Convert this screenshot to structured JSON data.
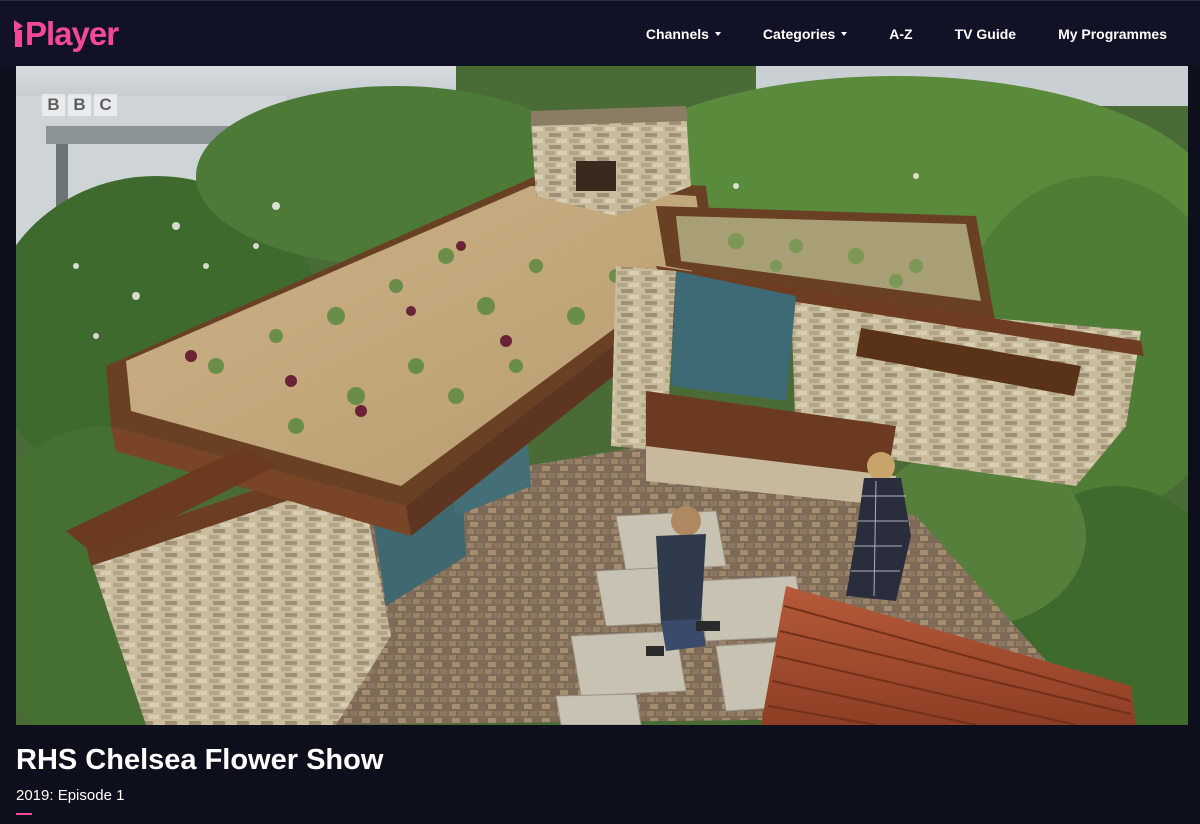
{
  "app": {
    "logo_text": "Player",
    "logo_icon": "iplayer-i-icon",
    "accent_color": "#f54997",
    "background_color": "#0e0f1d"
  },
  "nav": {
    "items": [
      {
        "label": "Channels",
        "has_dropdown": true
      },
      {
        "label": "Categories",
        "has_dropdown": true
      },
      {
        "label": "A-Z",
        "has_dropdown": false
      },
      {
        "label": "TV Guide",
        "has_dropdown": false
      },
      {
        "label": "My Programmes",
        "has_dropdown": false
      }
    ]
  },
  "player": {
    "channel_watermark": [
      "B",
      "B",
      "C"
    ]
  },
  "programme": {
    "title": "RHS Chelsea Flower Show",
    "episode": "2019: Episode 1"
  }
}
